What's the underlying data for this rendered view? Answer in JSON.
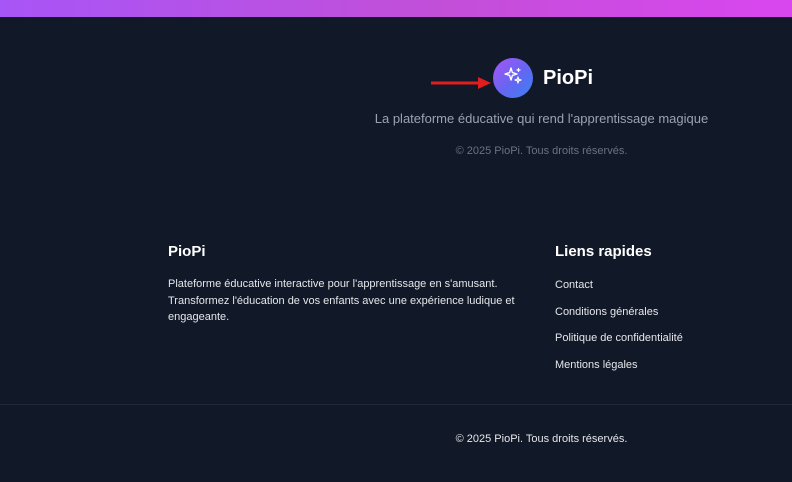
{
  "hero": {
    "brand_name": "PioPi",
    "logo_icon": "sparkles-icon",
    "tagline": "La plateforme éducative qui rend l'apprentissage magique",
    "copyright": "© 2025 PioPi. Tous droits réservés."
  },
  "annotation": {
    "arrow_color": "#e11d1d"
  },
  "footer": {
    "about": {
      "title": "PioPi",
      "text": "Plateforme éducative interactive pour l'apprentissage en s'amusant. Transformez l'éducation de vos enfants avec une expérience ludique et engageante."
    },
    "links": {
      "title": "Liens rapides",
      "items": [
        {
          "label": "Contact"
        },
        {
          "label": "Conditions générales"
        },
        {
          "label": "Politique de confidentialité"
        },
        {
          "label": "Mentions légales"
        }
      ]
    },
    "copyright": "© 2025 PioPi. Tous droits réservés."
  },
  "colors": {
    "background": "#111827",
    "top_bar_start": "#a855f7",
    "top_bar_end": "#d946ef",
    "logo_start": "#a855f7",
    "logo_end": "#3b82f6"
  }
}
